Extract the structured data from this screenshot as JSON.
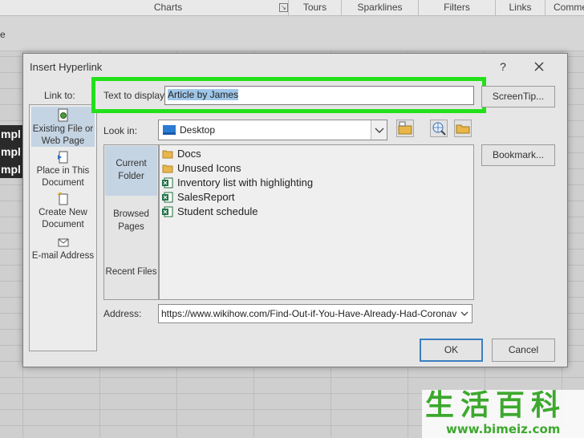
{
  "ribbon": {
    "groups": [
      {
        "label": "Charts"
      },
      {
        "label": "Tours"
      },
      {
        "label": "Sparklines"
      },
      {
        "label": "Filters"
      },
      {
        "label": "Links"
      },
      {
        "label": "Comme"
      }
    ],
    "left_fragment": "e"
  },
  "sheet": {
    "dark_cells": [
      "mpl",
      "mpl",
      "mpl"
    ]
  },
  "dialog": {
    "title": "Insert Hyperlink",
    "help": "?",
    "link_to_label": "Link to:",
    "link_to_items": [
      {
        "label": "Existing File or Web Page",
        "selected": true
      },
      {
        "label": "Place in This Document"
      },
      {
        "label": "Create New Document"
      },
      {
        "label": "E-mail Address"
      }
    ],
    "text_to_display_label": "Text to display:",
    "text_to_display_value": "Article by James",
    "screentip_label": "ScreenTip...",
    "bookmark_label": "Bookmark...",
    "look_in_label": "Look in:",
    "look_in_value": "Desktop",
    "places": [
      {
        "label": "Current Folder",
        "selected": true
      },
      {
        "label": "Browsed Pages"
      },
      {
        "label": "Recent Files"
      }
    ],
    "files": [
      {
        "name": "Docs",
        "icon": "folder-icon"
      },
      {
        "name": "Unused Icons",
        "icon": "folder-icon"
      },
      {
        "name": "Inventory list with highlighting",
        "icon": "excel-file-icon"
      },
      {
        "name": "SalesReport",
        "icon": "excel-file-icon"
      },
      {
        "name": "Student schedule",
        "icon": "excel-file-icon"
      }
    ],
    "address_label": "Address:",
    "address_value": "https://www.wikihow.com/Find-Out-if-You-Have-Already-Had-Coronavirus",
    "ok_label": "OK",
    "cancel_label": "Cancel"
  },
  "watermark": {
    "chars": "生活百科",
    "url": "www.bimeiz.com"
  },
  "colors": {
    "highlight_green": "#22e01a",
    "selection_blue": "#c5d4e3",
    "ok_border": "#3c7fc1"
  }
}
